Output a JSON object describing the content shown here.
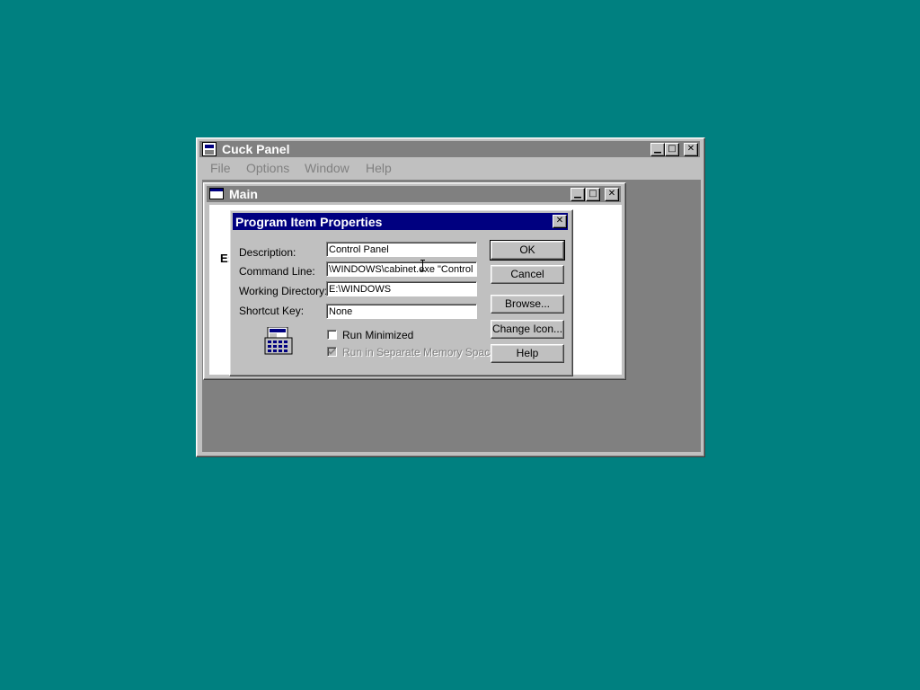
{
  "outer_window": {
    "title": "Cuck Panel",
    "menu": [
      "File",
      "Options",
      "Window",
      "Help"
    ],
    "controls": {
      "minimize": "▁",
      "maximize": "□",
      "close": "✕"
    }
  },
  "main_window": {
    "title": "Main",
    "drive_label": "E:",
    "controls": {
      "minimize": "▁",
      "maximize": "□",
      "close": "✕"
    }
  },
  "dialog": {
    "title": "Program Item Properties",
    "close": "✕",
    "fields": {
      "description": {
        "label": "Description:",
        "value": "Control Panel"
      },
      "command_line": {
        "label": "Command Line:",
        "value": "\\WINDOWS\\cabinet.exe \"Control"
      },
      "working_directory": {
        "label": "Working Directory:",
        "value": "E:\\WINDOWS"
      },
      "shortcut_key": {
        "label": "Shortcut Key:",
        "value": "None"
      }
    },
    "checkboxes": {
      "run_minimized": {
        "label": "Run Minimized",
        "checked": false
      },
      "separate_memory": {
        "label": "Run in Separate Memory Space",
        "checked": true,
        "disabled": true
      }
    },
    "buttons": {
      "ok": "OK",
      "cancel": "Cancel",
      "browse": "Browse...",
      "change_icon": "Change Icon...",
      "help": "Help"
    },
    "icon": "control-panel-icon"
  },
  "colors": {
    "desktop": "#008080",
    "active_title": "#000080",
    "inactive_title": "#808080",
    "face": "#c0c0c0"
  }
}
